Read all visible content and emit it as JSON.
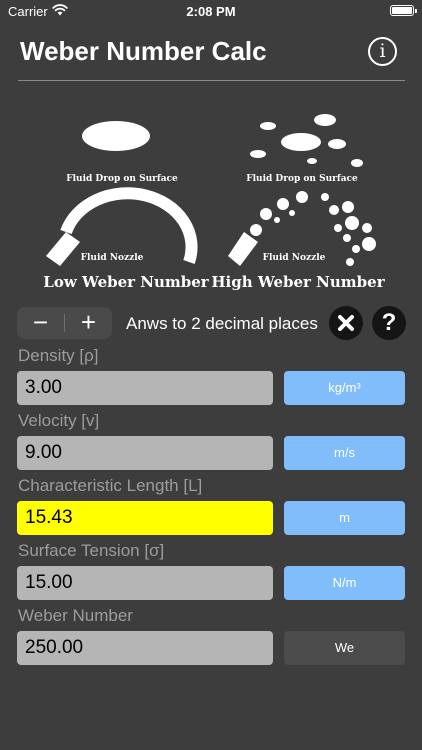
{
  "status_bar": {
    "carrier": "Carrier",
    "time": "2:08 PM"
  },
  "header": {
    "title": "Weber Number Calc",
    "info_label": "i"
  },
  "illustration": {
    "low": {
      "drop_caption": "Fluid Drop on Surface",
      "nozzle_caption": "Fluid Nozzle",
      "title": "Low Weber Number"
    },
    "high": {
      "drop_caption": "Fluid Drop on Surface",
      "nozzle_caption": "Fluid Nozzle",
      "title": "High Weber Number"
    }
  },
  "decimal": {
    "minus": "−",
    "plus": "+",
    "label": "Anws to 2 decimal places",
    "help": "?"
  },
  "fields": [
    {
      "label": "Density [ρ]",
      "value": "3.00",
      "unit": "kg/m³"
    },
    {
      "label": "Velocity [v]",
      "value": "9.00",
      "unit": "m/s"
    },
    {
      "label": "Characteristic Length [L]",
      "value": "15.43",
      "unit": "m"
    },
    {
      "label": "Surface Tension [σ]",
      "value": "15.00",
      "unit": "N/m"
    },
    {
      "label": "Weber Number",
      "value": "250.00",
      "unit": "We"
    }
  ],
  "colors": {
    "background": "#3d3d3d",
    "unit_button": "#82bdfb",
    "highlight": "#ffff00",
    "input": "#b5b5b5"
  }
}
